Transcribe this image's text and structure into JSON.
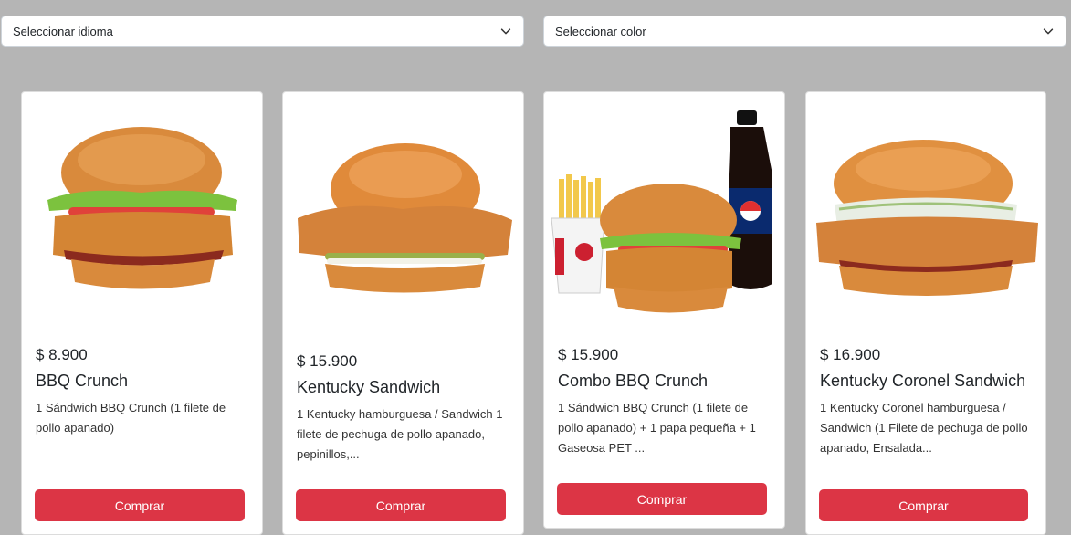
{
  "selects": {
    "language": {
      "placeholder": "Seleccionar idioma"
    },
    "color": {
      "placeholder": "Seleccionar color"
    }
  },
  "colors": {
    "background": "#b5b5b5",
    "button": "#dc3545",
    "bun": "#d98a3c",
    "lettuce": "#7cc23e",
    "tomato": "#e0423a",
    "chicken": "#d98b3c"
  },
  "products": [
    {
      "price": "$ 8.900",
      "name": "BBQ Crunch",
      "description": "1 Sándwich BBQ Crunch (1 filete de pollo apanado)",
      "button": "Comprar",
      "image": "burger-bbq-crunch"
    },
    {
      "price": "$ 15.900",
      "name": "Kentucky Sandwich",
      "description": "1 Kentucky hamburguesa / Sandwich 1 filete de pechuga de pollo apanado, pepinillos,...",
      "button": "Comprar",
      "image": "burger-kentucky"
    },
    {
      "price": "$ 15.900",
      "name": "Combo BBQ Crunch",
      "description": "1 Sándwich BBQ Crunch (1 filete de pollo apanado) + 1 papa pequeña + 1 Gaseosa PET ...",
      "button": "Comprar",
      "image": "combo-bbq-crunch"
    },
    {
      "price": "$ 16.900",
      "name": "Kentucky Coronel Sandwich",
      "description": "1 Kentucky Coronel hamburguesa / Sandwich (1 Filete de pechuga de pollo apanado, Ensalada...",
      "button": "Comprar",
      "image": "burger-coronel"
    }
  ]
}
